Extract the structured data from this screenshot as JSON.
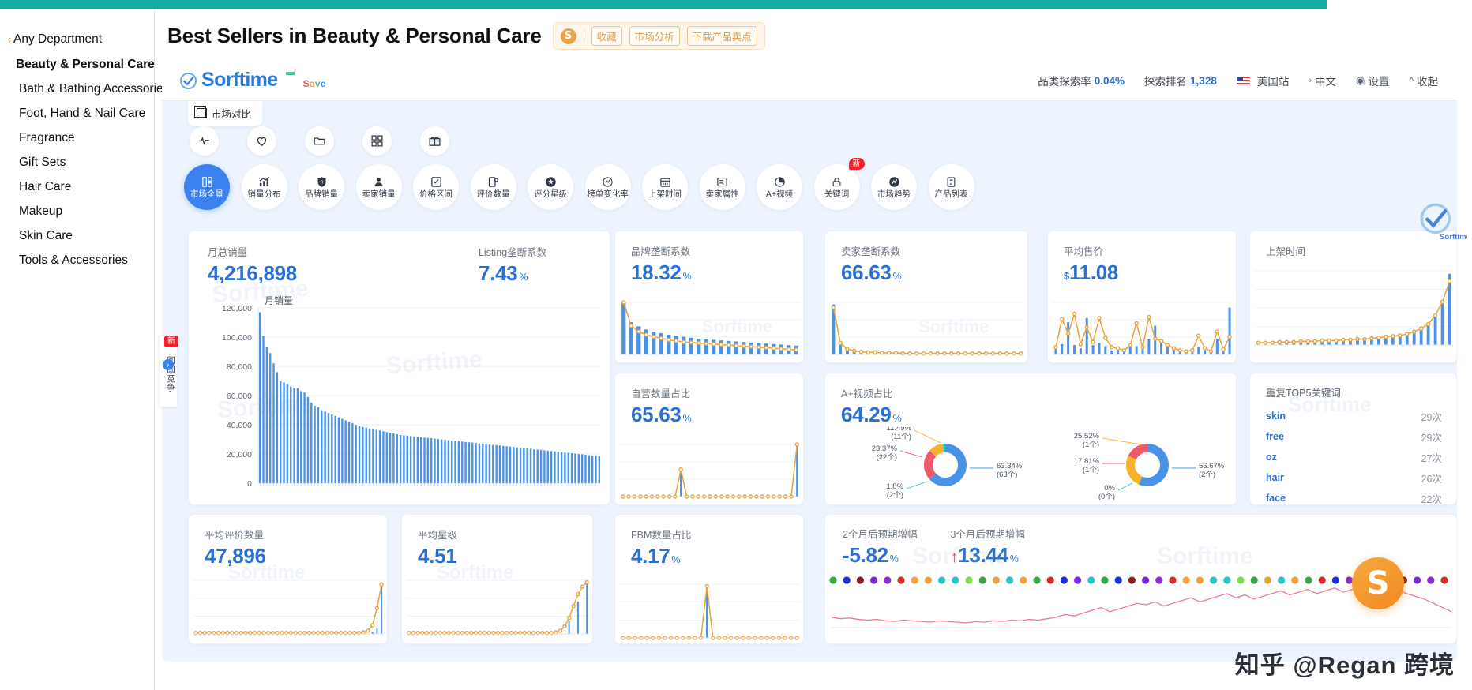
{
  "sidebar": {
    "any_department": "Any Department",
    "current": "Beauty & Personal Care",
    "items": [
      "Bath & Bathing Accessories",
      "Foot, Hand & Nail Care",
      "Fragrance",
      "Gift Sets",
      "Hair Care",
      "Makeup",
      "Skin Care",
      "Tools & Accessories"
    ]
  },
  "header": {
    "title": "Best Sellers in Beauty & Personal Care",
    "logo_letter": "S",
    "badges": [
      "收藏",
      "市场分析",
      "下载产品卖点"
    ]
  },
  "app": {
    "brand": "Sorftime",
    "brand_save": "Save",
    "market_compare": "市场对比",
    "topbar": {
      "explore_rate_label": "品类探索率",
      "explore_rate_value": "0.04%",
      "explore_rank_label": "探索排名",
      "explore_rank_value": "1,328",
      "site": "美国站",
      "language": "中文",
      "settings": "设置",
      "collapse": "收起"
    },
    "float_tab": {
      "label": "回国竞争",
      "new": "新"
    },
    "tools": [
      "pulse-icon",
      "heart-icon",
      "folder-icon",
      "grid-icon",
      "gift-icon"
    ],
    "tabs": [
      {
        "label": "市场全景",
        "icon": "dashboard-icon",
        "active": true,
        "new": false
      },
      {
        "label": "销量分布",
        "icon": "chart-up-icon",
        "active": false,
        "new": false
      },
      {
        "label": "品牌销量",
        "icon": "brand-shield-icon",
        "active": false,
        "new": false
      },
      {
        "label": "卖家销量",
        "icon": "seller-icon",
        "active": false,
        "new": false
      },
      {
        "label": "价格区间",
        "icon": "price-tag-icon",
        "active": false,
        "new": false
      },
      {
        "label": "评价数量",
        "icon": "review-icon",
        "active": false,
        "new": false
      },
      {
        "label": "评分星级",
        "icon": "star-rating-icon",
        "active": false,
        "new": false
      },
      {
        "label": "榜单变化率",
        "icon": "rank-change-icon",
        "active": false,
        "new": false
      },
      {
        "label": "上架时间",
        "icon": "calendar-icon",
        "active": false,
        "new": false
      },
      {
        "label": "卖家属性",
        "icon": "seller-attr-icon",
        "active": false,
        "new": false
      },
      {
        "label": "A+视频",
        "icon": "pie-icon",
        "active": false,
        "new": false
      },
      {
        "label": "关键词",
        "icon": "lock-icon",
        "active": false,
        "new": true
      },
      {
        "label": "市场趋势",
        "icon": "trend-icon",
        "active": false,
        "new": false
      },
      {
        "label": "产品列表",
        "icon": "list-icon",
        "active": false,
        "new": false
      }
    ],
    "new_badge": "新"
  },
  "cards": {
    "monthly_sales": {
      "label": "月总销量",
      "value": "4,216,898",
      "sub_label": "Listing垄断系数",
      "sub_value": "7.43",
      "sub_unit": "%",
      "chart_title": "月销量"
    },
    "brand_monopoly": {
      "label": "品牌垄断系数",
      "value": "18.32",
      "unit": "%"
    },
    "seller_monopoly": {
      "label": "卖家垄断系数",
      "value": "66.63",
      "unit": "%"
    },
    "avg_price": {
      "label": "平均售价",
      "prefix": "$",
      "value": "11.08"
    },
    "listing_time": {
      "label": "上架时间"
    },
    "self_operated": {
      "label": "自营数量占比",
      "value": "65.63",
      "unit": "%"
    },
    "aplus_video": {
      "label": "A+视频占比",
      "value": "64.29",
      "unit": "%"
    },
    "top_keywords": {
      "label": "重复TOP5关键词",
      "rows": [
        {
          "word": "skin",
          "count": "29次"
        },
        {
          "word": "free",
          "count": "29次"
        },
        {
          "word": "oz",
          "count": "27次"
        },
        {
          "word": "hair",
          "count": "26次"
        },
        {
          "word": "face",
          "count": "22次"
        }
      ]
    },
    "avg_reviews": {
      "label": "平均评价数量",
      "value": "47,896"
    },
    "avg_stars": {
      "label": "平均星级",
      "value": "4.51"
    },
    "fbm_ratio": {
      "label": "FBM数量占比",
      "value": "4.17",
      "unit": "%"
    },
    "forecast": {
      "m2_label": "2个月后预期增幅",
      "m2_value": "-5.82",
      "m2_unit": "%",
      "m3_label": "3个月后预期增幅",
      "m3_value": "13.44",
      "m3_unit": "%",
      "m3_arrow": "↑"
    }
  },
  "watermarks": {
    "brand": "Sorftime",
    "zhihu": "知乎 @Regan 跨境",
    "s_mark": "S"
  },
  "colors": {
    "accent_blue": "#2b6fd1",
    "bar_blue": "#4a92e8",
    "line_orange": "#e8a33d",
    "red": "#f0596a",
    "teal": "#2ac4c4",
    "amber": "#f7b32b",
    "brand_orange": "#ef8a22",
    "top_strip": "#19a9a0"
  },
  "chart_data": [
    {
      "id": "monthly-sales-bars",
      "type": "bar",
      "title": "月销量",
      "ylabel": "",
      "ylim": [
        0,
        120000
      ],
      "yticks": [
        0,
        20000,
        40000,
        60000,
        80000,
        100000,
        120000
      ],
      "ytick_labels": [
        "0",
        "20,000",
        "40,000",
        "60,000",
        "80,000",
        "100,000",
        "120,000"
      ],
      "grid": true,
      "values": [
        117000,
        101000,
        93000,
        89000,
        82000,
        76000,
        70000,
        69000,
        68000,
        66000,
        65000,
        65000,
        63000,
        62000,
        59000,
        55000,
        53000,
        52000,
        50000,
        49000,
        48000,
        47000,
        46000,
        45000,
        44000,
        43000,
        42000,
        41000,
        40000,
        39000,
        38500,
        38000,
        37500,
        37000,
        36500,
        36000,
        35500,
        35000,
        34500,
        34000,
        33500,
        33000,
        32800,
        32500,
        32200,
        32000,
        31800,
        31500,
        31200,
        31000,
        30800,
        30500,
        30200,
        30000,
        29800,
        29500,
        29200,
        29000,
        28800,
        28500,
        28200,
        28000,
        27800,
        27500,
        27200,
        27000,
        26800,
        26500,
        26200,
        26000,
        25800,
        25500,
        25200,
        25000,
        24800,
        24500,
        24200,
        24000,
        23800,
        23500,
        23200,
        23000,
        22800,
        22500,
        22200,
        22000,
        21800,
        21500,
        21200,
        21000,
        20800,
        20500,
        20200,
        20000,
        19800,
        19500,
        19200,
        19000,
        18800,
        18500
      ]
    },
    {
      "id": "brand-monopoly-mini",
      "type": "bar-line",
      "title": "品牌垄断系数",
      "bars": [
        100,
        62,
        54,
        48,
        44,
        41,
        38,
        36,
        34,
        32,
        30,
        29,
        28,
        27,
        26,
        25,
        24,
        23,
        22,
        21,
        20,
        19,
        18,
        17
      ],
      "line": [
        100,
        55,
        44,
        38,
        34,
        31,
        28,
        26,
        24,
        23,
        22,
        21,
        20,
        19,
        18,
        17,
        16,
        15,
        14,
        13,
        12,
        11,
        10,
        9
      ]
    },
    {
      "id": "seller-monopoly-mini",
      "type": "bar-line",
      "title": "卖家垄断系数",
      "bars": [
        96,
        18,
        8,
        6,
        5,
        4,
        4,
        3,
        3,
        3,
        2,
        2,
        2,
        2,
        2,
        2,
        2,
        2,
        2,
        2,
        2,
        2,
        2,
        2,
        2,
        2,
        2,
        2
      ],
      "line": [
        90,
        22,
        10,
        7,
        5,
        4,
        4,
        3,
        3,
        3,
        2,
        2,
        2,
        2,
        2,
        2,
        2,
        2,
        2,
        2,
        2,
        2,
        2,
        2,
        2,
        2,
        2,
        2
      ]
    },
    {
      "id": "avg-price-mini",
      "type": "bar-line",
      "title": "平均售价",
      "bars": [
        10,
        20,
        62,
        18,
        12,
        70,
        18,
        22,
        16,
        8,
        10,
        6,
        14,
        16,
        10,
        30,
        55,
        22,
        14,
        10,
        6,
        4,
        4,
        14,
        8,
        4,
        30,
        6,
        90
      ],
      "line": [
        14,
        68,
        40,
        78,
        20,
        52,
        24,
        70,
        32,
        14,
        12,
        8,
        18,
        60,
        14,
        72,
        30,
        26,
        18,
        12,
        8,
        6,
        8,
        36,
        12,
        6,
        44,
        10,
        34
      ]
    },
    {
      "id": "listing-time-mini",
      "type": "bar-line",
      "title": "上架时间",
      "bars": [
        2,
        2,
        3,
        3,
        3,
        4,
        4,
        4,
        5,
        5,
        5,
        6,
        6,
        7,
        7,
        8,
        8,
        9,
        10,
        11,
        12,
        14,
        16,
        20,
        26,
        38,
        56,
        96
      ],
      "line": [
        3,
        3,
        3,
        4,
        4,
        4,
        5,
        5,
        5,
        6,
        6,
        6,
        7,
        7,
        8,
        8,
        9,
        10,
        11,
        12,
        13,
        15,
        18,
        22,
        28,
        40,
        58,
        86
      ]
    },
    {
      "id": "self-operated-mini",
      "type": "bar-line",
      "title": "自营数量占比",
      "bars": [
        0,
        0,
        0,
        0,
        0,
        0,
        0,
        0,
        0,
        0,
        52,
        0,
        0,
        0,
        0,
        0,
        0,
        0,
        0,
        0,
        0,
        0,
        0,
        0,
        0,
        0,
        0,
        0,
        0,
        0,
        100
      ],
      "line": [
        0,
        0,
        0,
        0,
        0,
        0,
        0,
        0,
        0,
        0,
        52,
        0,
        0,
        0,
        0,
        0,
        0,
        0,
        0,
        0,
        0,
        0,
        0,
        0,
        0,
        0,
        0,
        0,
        0,
        0,
        100
      ]
    },
    {
      "id": "aplus-video-donut-1",
      "type": "pie",
      "title": "A+视频占比 donut 1",
      "labels": [
        "63.34%\n(63个)",
        "23.37%\n(22个)",
        "11.49%\n(11个)",
        "1.8%\n(2个)"
      ],
      "values": [
        63.34,
        23.37,
        11.49,
        1.8
      ],
      "colors": [
        "#4a92e8",
        "#f0596a",
        "#f7b32b",
        "#2ac4c4"
      ]
    },
    {
      "id": "aplus-video-donut-2",
      "type": "pie",
      "title": "A+视频占比 donut 2",
      "labels": [
        "56.67%\n(2个)",
        "25.52%\n(1个)",
        "17.81%\n(1个)",
        "0%\n(0个)"
      ],
      "values": [
        56.67,
        25.52,
        17.81,
        0
      ],
      "colors": [
        "#4a92e8",
        "#f7b32b",
        "#f0596a",
        "#2ac4c4"
      ]
    },
    {
      "id": "avg-reviews-mini",
      "type": "bar-line",
      "title": "平均评价数量",
      "bars": [
        0,
        0,
        0,
        0,
        0,
        0,
        0,
        0,
        0,
        0,
        0,
        0,
        0,
        0,
        0,
        0,
        0,
        0,
        0,
        0,
        0,
        0,
        0,
        0,
        0,
        0,
        0,
        0,
        0,
        0,
        0,
        0,
        0,
        0,
        0,
        0,
        0,
        0,
        0,
        4,
        10,
        96
      ],
      "line": [
        2,
        2,
        2,
        2,
        2,
        2,
        2,
        2,
        2,
        2,
        2,
        2,
        2,
        2,
        2,
        2,
        2,
        2,
        2,
        2,
        2,
        2,
        2,
        2,
        2,
        2,
        2,
        2,
        2,
        2,
        2,
        2,
        2,
        2,
        2,
        2,
        2,
        3,
        6,
        16,
        48,
        92
      ]
    },
    {
      "id": "avg-stars-mini",
      "type": "bar-line",
      "title": "平均星级",
      "bars": [
        0,
        0,
        0,
        0,
        0,
        0,
        0,
        0,
        0,
        0,
        0,
        0,
        0,
        0,
        0,
        0,
        0,
        0,
        0,
        0,
        0,
        0,
        0,
        0,
        0,
        0,
        0,
        0,
        0,
        0,
        0,
        0,
        0,
        0,
        0,
        0,
        24,
        0,
        60,
        0,
        96
      ],
      "line": [
        2,
        2,
        2,
        2,
        2,
        2,
        2,
        2,
        2,
        2,
        2,
        2,
        2,
        2,
        2,
        2,
        2,
        2,
        2,
        2,
        2,
        2,
        2,
        2,
        2,
        2,
        2,
        2,
        2,
        2,
        2,
        2,
        2,
        3,
        6,
        14,
        30,
        52,
        74,
        88,
        96
      ]
    },
    {
      "id": "fbm-ratio-mini",
      "type": "bar-line",
      "title": "FBM数量占比",
      "bars": [
        0,
        0,
        0,
        0,
        0,
        0,
        0,
        0,
        0,
        0,
        0,
        0,
        0,
        0,
        96,
        0,
        0,
        0,
        0,
        0,
        0,
        0,
        0,
        0,
        0,
        0,
        0,
        0,
        0,
        0
      ],
      "line": [
        0,
        0,
        0,
        0,
        0,
        0,
        0,
        0,
        0,
        0,
        0,
        0,
        0,
        0,
        96,
        0,
        0,
        0,
        0,
        0,
        0,
        0,
        0,
        0,
        0,
        0,
        0,
        0,
        0,
        0
      ]
    },
    {
      "id": "market-trend-mini",
      "type": "line",
      "title": "市场趋势",
      "ylabel": "",
      "values": [
        30,
        28,
        29,
        27,
        26,
        27,
        25,
        24,
        26,
        25,
        24,
        23,
        25,
        24,
        23,
        22,
        24,
        23,
        25,
        24,
        26,
        25,
        27,
        26,
        28,
        30,
        34,
        32,
        36,
        40,
        44,
        38,
        42,
        46,
        50,
        48,
        52,
        46,
        50,
        54,
        58,
        52,
        56,
        60,
        64,
        58,
        62,
        56,
        60,
        64,
        68,
        62,
        66,
        70,
        64,
        68,
        72,
        66,
        70,
        74,
        68,
        72,
        66,
        70,
        64,
        60,
        56,
        50,
        44,
        38
      ]
    }
  ]
}
